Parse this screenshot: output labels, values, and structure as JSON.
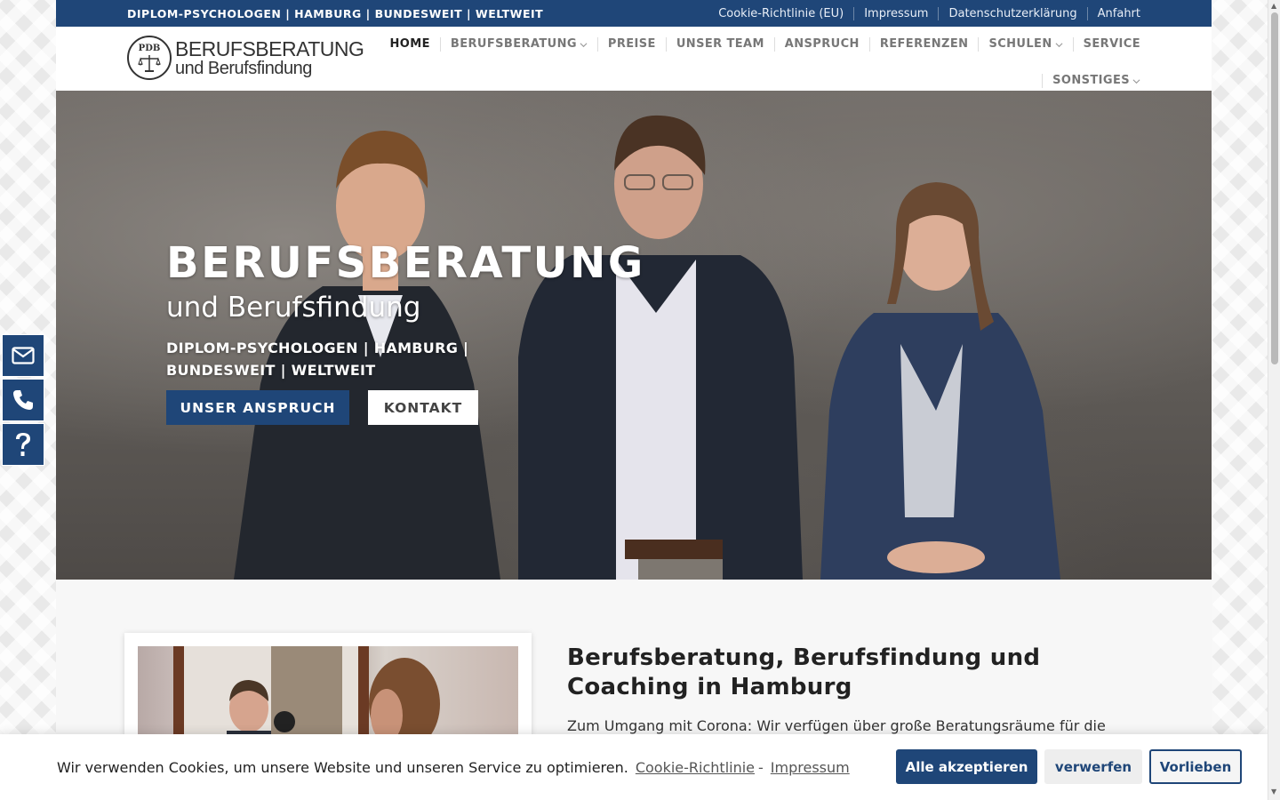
{
  "topbar": {
    "tagline": "DIPLOM-PSYCHOLOGEN | HAMBURG | BUNDESWEIT | WELTWEIT",
    "links": [
      "Cookie-Richtlinie (EU)",
      "Impressum",
      "Datenschutzerklärung",
      "Anfahrt"
    ]
  },
  "logo": {
    "emblem": "PDB",
    "line1": "BERUFSBERATUNG",
    "line2": "und Berufsfindung"
  },
  "nav": {
    "row1": [
      {
        "label": "HOME",
        "active": true,
        "dropdown": false
      },
      {
        "label": "BERUFSBERATUNG",
        "active": false,
        "dropdown": true
      },
      {
        "label": "PREISE",
        "active": false,
        "dropdown": false
      },
      {
        "label": "UNSER TEAM",
        "active": false,
        "dropdown": false
      },
      {
        "label": "ANSPRUCH",
        "active": false,
        "dropdown": false
      },
      {
        "label": "REFERENZEN",
        "active": false,
        "dropdown": false
      },
      {
        "label": "SCHULEN",
        "active": false,
        "dropdown": true
      },
      {
        "label": "SERVICE",
        "active": false,
        "dropdown": false
      }
    ],
    "row2": [
      {
        "label": "SONSTIGES",
        "active": false,
        "dropdown": true
      }
    ]
  },
  "hero": {
    "title": "BERUFSBERATUNG",
    "subtitle": "und Berufsfindung",
    "tagline": "DIPLOM-PSYCHOLOGEN | HAMBURG | BUNDESWEIT | WELTWEIT",
    "primary_button": "UNSER ANSPRUCH",
    "secondary_button": "KONTAKT"
  },
  "content": {
    "title": "Berufsberatung, Berufsfindung und Coaching in Hamburg",
    "text": "Zum Umgang mit Corona: Wir verfügen über große Beratungsräume für die"
  },
  "sidebar": {
    "icons": [
      "envelope-icon",
      "phone-icon",
      "question-icon"
    ]
  },
  "cookie": {
    "text": "Wir verwenden Cookies, um unsere Website und unseren Service zu optimieren.",
    "link1": "Cookie-Richtlinie",
    "separator": "-",
    "link2": "Impressum",
    "accept": "Alle akzeptieren",
    "reject": "verwerfen",
    "preferences": "Vorlieben"
  },
  "colors": {
    "brand": "#1f4678",
    "nav_inactive": "#777777",
    "nav_active": "#222222"
  }
}
